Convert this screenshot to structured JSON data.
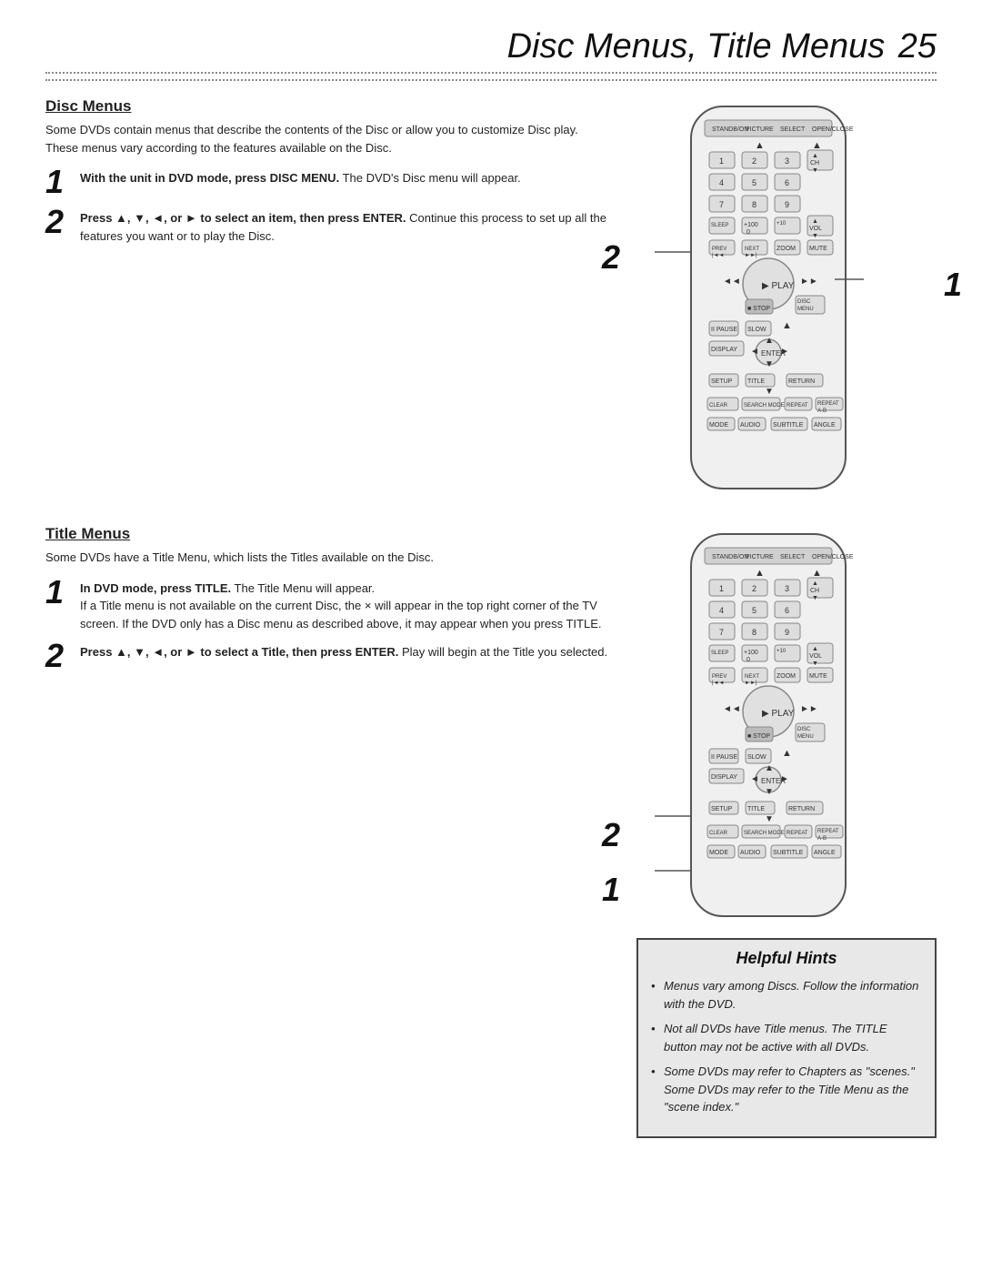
{
  "page": {
    "title": "Disc Menus, Title Menus",
    "page_number": "25",
    "dotted_line": true
  },
  "disc_menus": {
    "title": "Disc Menus",
    "description": "Some DVDs contain menus that describe the contents of the Disc or allow you to customize Disc play. These menus vary according to the features available on the Disc.",
    "step1": {
      "number": "1",
      "text_bold": "With the unit in DVD mode, press DISC MENU.",
      "text_normal": " The DVD's Disc menu will appear."
    },
    "step2": {
      "number": "2",
      "text_bold": "Press ▲, ▼, ◄, or ► to select an item, then press ENTER.",
      "text_normal": " Continue this process to set up all the features you want or to play the Disc."
    }
  },
  "title_menus": {
    "title": "Title Menus",
    "description": "Some DVDs have a Title Menu, which lists the Titles available on the Disc.",
    "step1": {
      "number": "1",
      "text_bold": "In DVD mode, press TITLE.",
      "text_normal": " The Title Menu will appear.\nIf a Title menu is not available on the current Disc, the × will appear in the top right corner of the TV screen. If the DVD only has a Disc menu as described above, it may appear when you press TITLE."
    },
    "step2": {
      "number": "2",
      "text_bold": "Press ▲, ▼, ◄, or ► to select a Title, then press ENTER.",
      "text_normal": " Play will begin at the Title you selected."
    }
  },
  "helpful_hints": {
    "title": "Helpful Hints",
    "hints": [
      "Menus vary among Discs. Follow the information with the DVD.",
      "Not all DVDs have Title menus. The TITLE button may not be active with all DVDs.",
      "Some DVDs may refer to Chapters as \"scenes.\" Some DVDs may refer to the Title Menu as the \"scene index.\""
    ]
  }
}
